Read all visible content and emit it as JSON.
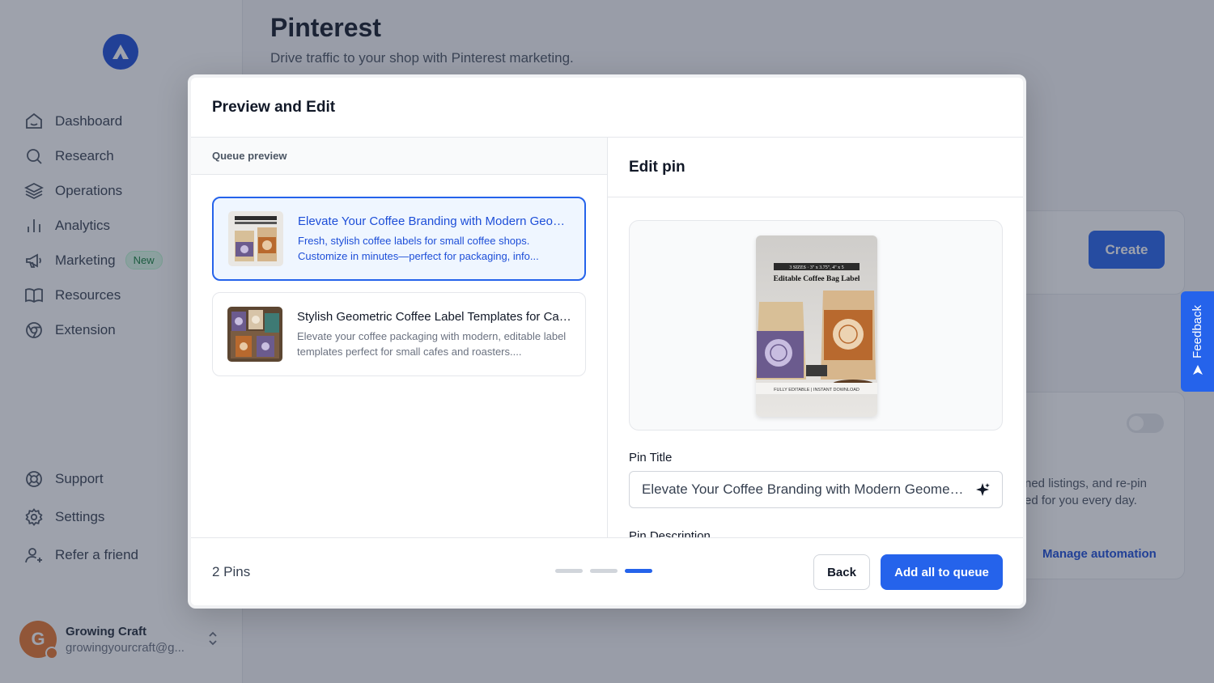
{
  "sidebar": {
    "nav": [
      {
        "label": "Dashboard",
        "icon": "home-icon"
      },
      {
        "label": "Research",
        "icon": "search-icon"
      },
      {
        "label": "Operations",
        "icon": "layers-icon"
      },
      {
        "label": "Analytics",
        "icon": "bar-chart-icon"
      },
      {
        "label": "Marketing",
        "icon": "megaphone-icon",
        "badge": "New"
      },
      {
        "label": "Resources",
        "icon": "book-icon"
      },
      {
        "label": "Extension",
        "icon": "chrome-icon"
      }
    ],
    "bottom_nav": [
      {
        "label": "Support",
        "icon": "lifebuoy-icon"
      },
      {
        "label": "Settings",
        "icon": "gear-icon"
      },
      {
        "label": "Refer a friend",
        "icon": "user-plus-icon"
      }
    ],
    "user": {
      "name": "Growing Craft",
      "email": "growingyourcraft@g...",
      "avatar_letter": "G"
    }
  },
  "page": {
    "title": "Pinterest",
    "subtitle": "Drive traffic to your shop with Pinterest marketing.",
    "create_label": "Create",
    "bg_text": "ned listings, and re-pin\ned for you every day.",
    "manage_label": "Manage automation"
  },
  "feedback_label": "Feedback",
  "modal": {
    "title": "Preview and Edit",
    "queue_heading": "Queue preview",
    "pins": [
      {
        "title": "Elevate Your Coffee Branding with Modern Geometric Labels",
        "description": "Fresh, stylish coffee labels for small coffee shops. Customize in minutes—perfect for packaging, info...",
        "selected": true
      },
      {
        "title": "Stylish Geometric Coffee Label Templates for Cafes",
        "description": "Elevate your coffee packaging with modern, editable label templates perfect for small cafes and roasters....",
        "selected": false
      }
    ],
    "edit_heading": "Edit pin",
    "preview_image": {
      "banner": "3 SIZES · 3\" x 3.75\", 4\" x 5",
      "heading": "Editable Coffee Bag Label",
      "footer": "FULLY EDITABLE | INSTANT DOWNLOAD"
    },
    "pin_title_label": "Pin Title",
    "pin_title_value": "Elevate Your Coffee Branding with Modern Geometric Labels",
    "pin_description_label": "Pin Description",
    "pins_count": "2 Pins",
    "steps": {
      "total": 3,
      "current": 3
    },
    "back_label": "Back",
    "add_label": "Add all to queue"
  },
  "colors": {
    "accent": "#2563eb",
    "badge_bg": "#dcfce7",
    "badge_text": "#15803d",
    "avatar": "#e8762c"
  }
}
